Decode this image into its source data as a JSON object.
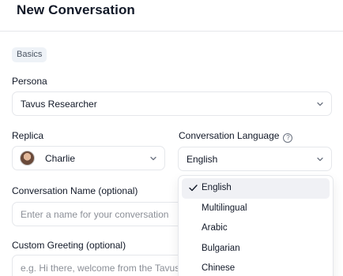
{
  "header": {
    "title": "New Conversation"
  },
  "section_tag": "Basics",
  "persona": {
    "label": "Persona",
    "value": "Tavus Researcher"
  },
  "replica": {
    "label": "Replica",
    "value": "Charlie"
  },
  "language": {
    "label": "Conversation Language",
    "value": "English",
    "options": [
      "English",
      "Multilingual",
      "Arabic",
      "Bulgarian",
      "Chinese"
    ],
    "selected": "English"
  },
  "conversation_name": {
    "label": "Conversation Name (optional)",
    "placeholder": "Enter a name for your conversation"
  },
  "custom_greeting": {
    "label": "Custom Greeting (optional)",
    "placeholder": "e.g. Hi there, welcome from the Tavus team"
  },
  "icons": {
    "help": "help-circle-icon",
    "chevron": "chevron-down-icon",
    "check": "check-icon"
  }
}
